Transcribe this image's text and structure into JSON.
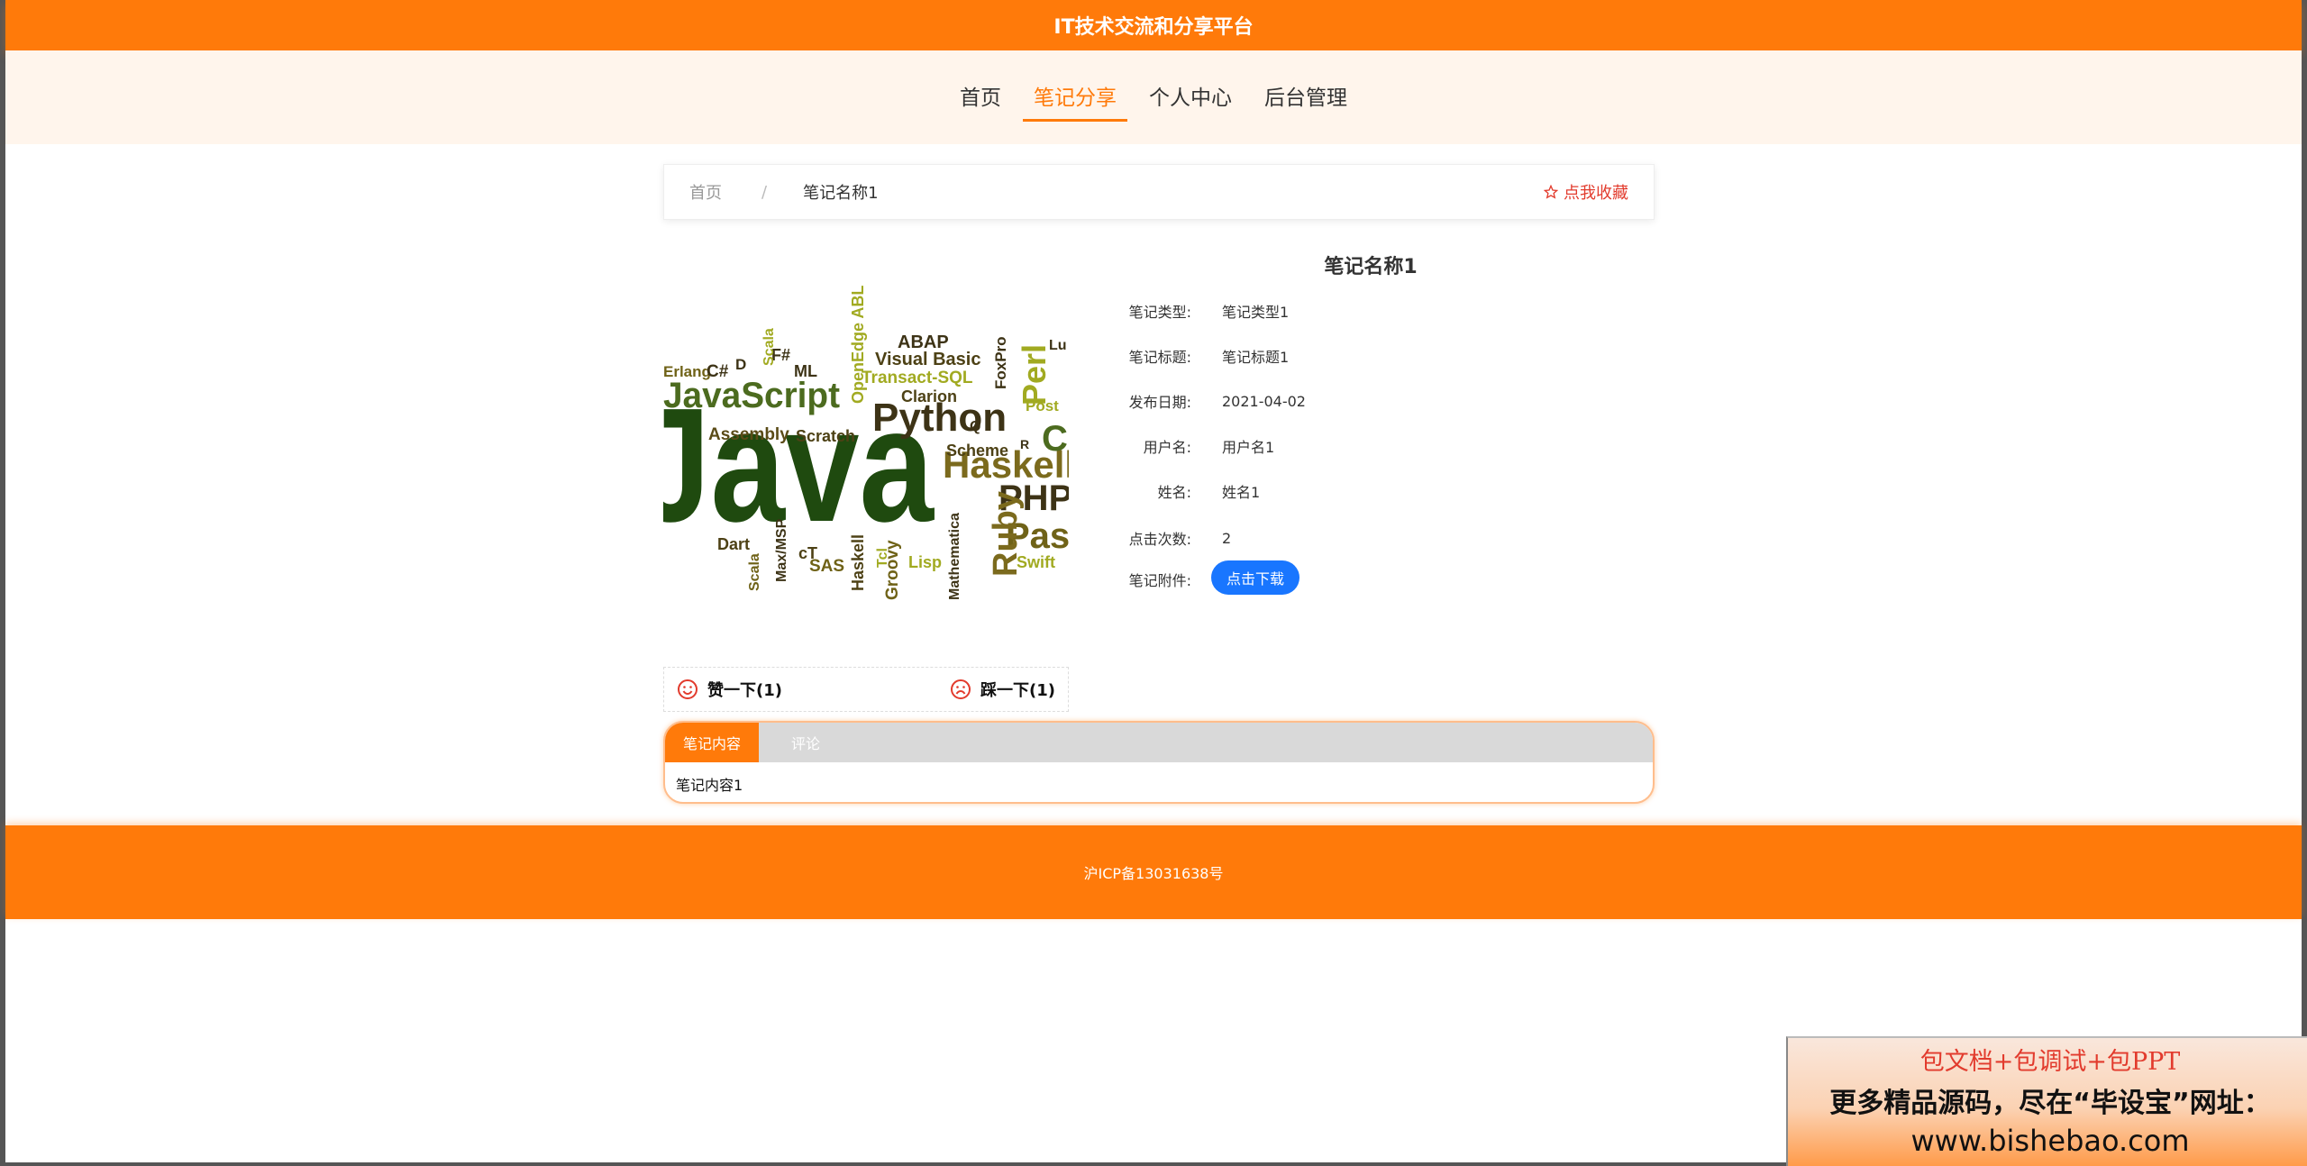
{
  "header": {
    "title": "IT技术交流和分享平台"
  },
  "nav": {
    "items": [
      {
        "label": "首页"
      },
      {
        "label": "笔记分享"
      },
      {
        "label": "个人中心"
      },
      {
        "label": "后台管理"
      }
    ],
    "active_index": 1
  },
  "breadcrumb": {
    "home": "首页",
    "separator": "/",
    "current": "笔记名称1",
    "favorite": "点我收藏"
  },
  "cover": {
    "alt": "Java programming languages word cloud",
    "words": [
      "Java",
      "JavaScript",
      "Python",
      "Haskell",
      "Ruby",
      "Perl",
      "PHP",
      "Pascal",
      "Visual Basic",
      "Transact-SQL",
      "ABAP",
      "Clarion",
      "Assembly",
      "Scratch",
      "Scheme",
      "OpenEdge ABL",
      "Scala",
      "F#",
      "ML",
      "C#",
      "D",
      "Erlang",
      "FoxPro",
      "Dart",
      "Max/MSP",
      "SAS",
      "cT",
      "Tcl",
      "Groovy",
      "Lisp",
      "Mathematica",
      "Swift",
      "Postscript",
      "Q",
      "R",
      "Lua",
      "C"
    ]
  },
  "detail": {
    "title": "笔记名称1",
    "fields": [
      {
        "key": "笔记类型:",
        "value": "笔记类型1"
      },
      {
        "key": "笔记标题:",
        "value": "笔记标题1"
      },
      {
        "key": "发布日期:",
        "value": "2021-04-02"
      },
      {
        "key": "用户名:",
        "value": "用户名1"
      },
      {
        "key": "姓名:",
        "value": "姓名1"
      },
      {
        "key": "点击次数:",
        "value": "2"
      }
    ],
    "attachment_label": "笔记附件:",
    "download_button": "点击下载"
  },
  "vote": {
    "like": "赞一下(1)",
    "dislike": "踩一下(1)"
  },
  "tabs": {
    "items": [
      {
        "label": "笔记内容"
      },
      {
        "label": "评论"
      }
    ],
    "active_index": 0,
    "content": "笔记内容1"
  },
  "footer": {
    "icp": "沪ICP备13031638号"
  },
  "ad": {
    "line1": "包文档+包调试+包PPT",
    "line2": "更多精品源码，尽在“毕设宝”网址：",
    "line3": "www.bishebao.com"
  },
  "colors": {
    "accent": "#ff7a0a",
    "nav_bg": "#fff5ec",
    "button_blue": "#1976ff",
    "favorite_red": "#e23b2d"
  }
}
